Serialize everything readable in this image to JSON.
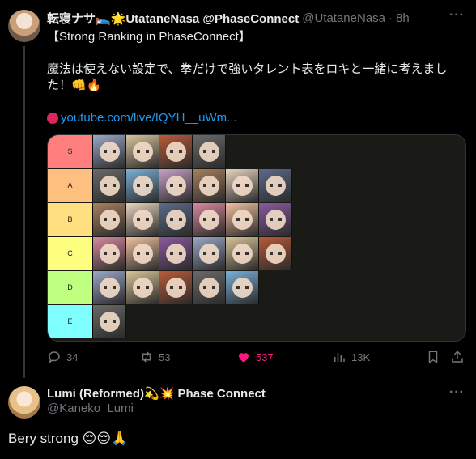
{
  "tweet": {
    "display_name": "転寝ナサ🛌🌟UtataneNasa @PhaseConnect",
    "handle": "@UtataneNasa",
    "separator": "·",
    "time": "8h",
    "more_label": "···",
    "line1": "【Strong Ranking in PhaseConnect】",
    "line2": "魔法は使えない設定で、拳だけで強いタレント表をロキと一緒に考えまし",
    "line3": "た！👊🔥",
    "link": "youtube.com/live/IQYH__uWm...",
    "tiers": [
      {
        "label": "S",
        "color": "#ff7f7f",
        "count": 4
      },
      {
        "label": "A",
        "color": "#ffbf7f",
        "count": 6
      },
      {
        "label": "B",
        "color": "#ffdf7f",
        "count": 6
      },
      {
        "label": "C",
        "color": "#ffff7f",
        "count": 6
      },
      {
        "label": "D",
        "color": "#bfff7f",
        "count": 5
      },
      {
        "label": "E",
        "color": "#7fffff",
        "count": 1
      }
    ],
    "actions": {
      "reply_count": "34",
      "repost_count": "53",
      "like_count": "537",
      "views_count": "13K"
    }
  },
  "reply": {
    "display_name": "Lumi (Reformed)💫💥 Phase Connect",
    "handle": "@Kaneko_Lumi",
    "more_label": "···",
    "text": "Bery strong 😌😌🙏"
  },
  "colors": {
    "background": "#000000",
    "link": "#1d9bf0",
    "like": "#f91880",
    "muted": "#71767b"
  }
}
